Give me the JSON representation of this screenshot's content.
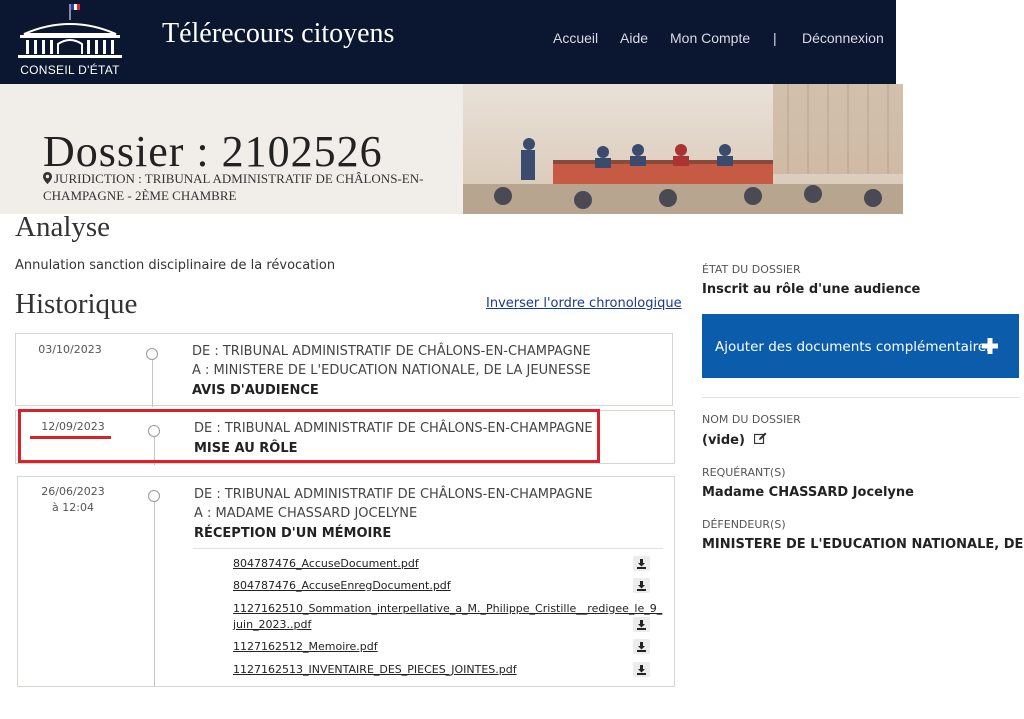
{
  "header": {
    "logo_text": "CONSEIL D'ÉTAT",
    "app_title": "Télérecours citoyens",
    "nav": [
      "Accueil",
      "Aide",
      "Mon Compte",
      "Déconnexion"
    ],
    "nav_separator": "|",
    "bg_color": "#0b1630"
  },
  "banner": {
    "title": "Dossier : 2102526",
    "juridiction": "JURIDICTION : TRIBUNAL ADMINISTRATIF DE CHÂLONS-EN-CHAMPAGNE - 2ÈME CHAMBRE",
    "pin_icon": "map-marker-icon"
  },
  "analyse": {
    "heading": "Analyse",
    "text": "Annulation sanction disciplinaire de la révocation"
  },
  "historique": {
    "heading": "Historique",
    "invert_link": "Inverser l'ordre chronologique",
    "entries": [
      {
        "date": "03/10/2023",
        "from": "DE : TRIBUNAL ADMINISTRATIF DE CHÂLONS-EN-CHAMPAGNE",
        "to": "A : MINISTERE DE L'EDUCATION NATIONALE, DE LA JEUNESSE",
        "type": "AVIS D'AUDIENCE"
      },
      {
        "date": "12/09/2023",
        "from": "DE : TRIBUNAL ADMINISTRATIF DE CHÂLONS-EN-CHAMPAGNE",
        "type": "MISE AU RÔLE"
      },
      {
        "date": "26/06/2023",
        "time": "à 12:04",
        "from": "DE : TRIBUNAL ADMINISTRATIF DE CHÂLONS-EN-CHAMPAGNE",
        "to": "A : MADAME CHASSARD JOCELYNE",
        "type": "RÉCEPTION D'UN MÉMOIRE",
        "files": [
          "804787476_AccuseDocument.pdf",
          "804787476_AccuseEnregDocument.pdf",
          "1127162510_Sommation_interpellative_a_M._Philippe_Cristille__redigee_le_9_juin_2023..pdf",
          "1127162512_Memoire.pdf",
          "1127162513_INVENTAIRE_DES_PIECES_JOINTES.pdf"
        ]
      }
    ],
    "highlight_color": "#d8232a"
  },
  "sidebar": {
    "etat_label": "ÉTAT DU DOSSIER",
    "etat_value": "Inscrit au rôle d'une audience",
    "add_button": "Ajouter des documents complémentaires",
    "add_button_color": "#0b5cab",
    "nom_label": "NOM DU DOSSIER",
    "nom_value": "(vide)",
    "edit_icon": "edit-icon",
    "requerant_label": "REQUÉRANT(S)",
    "requerant_value": "Madame CHASSARD Jocelyne",
    "defendeur_label": "DÉFENDEUR(S)",
    "defendeur_value": "MINISTERE DE L'EDUCATION NATIONALE, DE LA J..."
  }
}
